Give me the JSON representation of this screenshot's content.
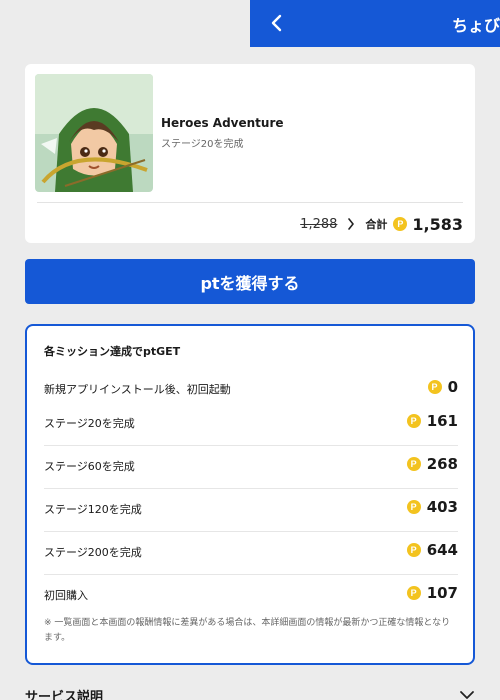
{
  "header": {
    "title": "ちょび"
  },
  "app": {
    "name": "Heroes Adventure",
    "subtitle": "ステージ20を完成",
    "old_points": "1,288",
    "total_label": "合計",
    "total_points": "1,583",
    "coin_symbol": "P"
  },
  "cta": {
    "label": "ptを獲得する"
  },
  "missions": {
    "title": "各ミッション達成でptGET",
    "items": [
      {
        "label": "新規アプリインストール後、初回起動",
        "points": "0"
      },
      {
        "label": "ステージ20を完成",
        "points": "161"
      },
      {
        "label": "ステージ60を完成",
        "points": "268"
      },
      {
        "label": "ステージ120を完成",
        "points": "403"
      },
      {
        "label": "ステージ200を完成",
        "points": "644"
      },
      {
        "label": "初回購入",
        "points": "107"
      }
    ],
    "note": "※ 一覧画面と本画面の報酬情報に差異がある場合は、本詳細画面の情報が最新かつ正確な情報となります。"
  },
  "service": {
    "title": "サービス説明"
  },
  "colors": {
    "primary": "#1558d6",
    "coin": "#f3c31f",
    "background": "#ececec"
  },
  "icons": {
    "back": "chevron-left-icon",
    "arrow": "chevron-right-icon",
    "coin": "coin-icon",
    "expand": "chevron-down-icon"
  }
}
